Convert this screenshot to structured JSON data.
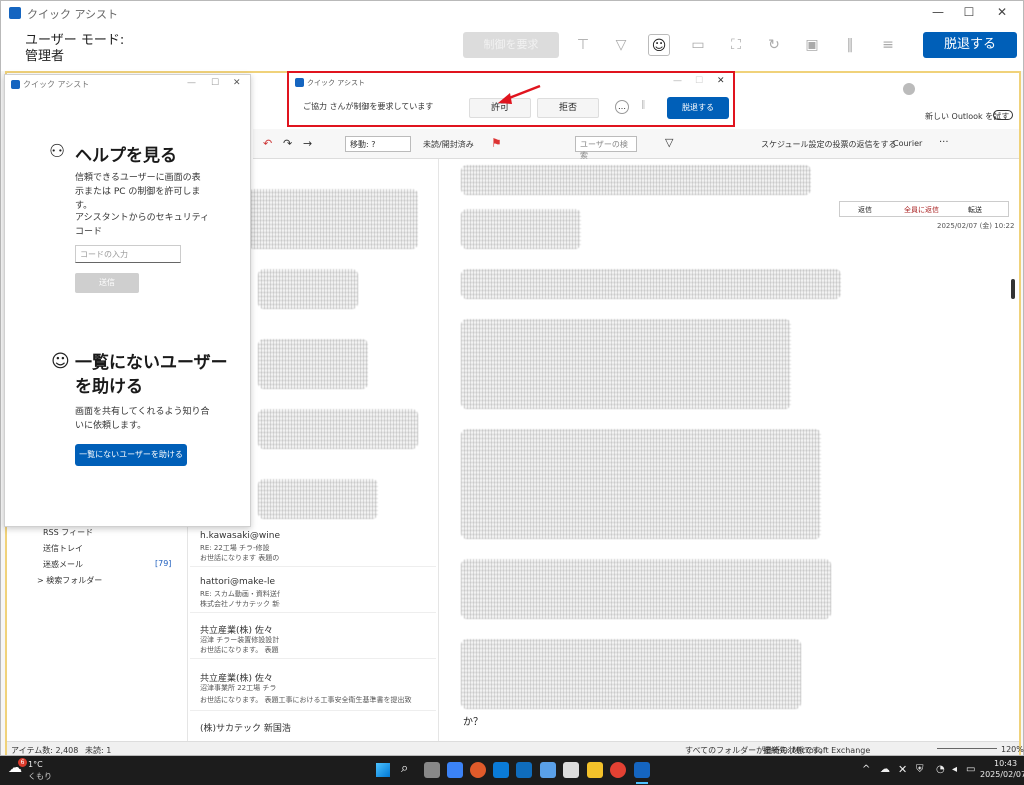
{
  "window": {
    "title": "クイック アシスト",
    "minimize": "—",
    "maximize": "☐",
    "close": "✕"
  },
  "mode": {
    "label": "ユーザー モード:",
    "role": "管理者",
    "disabled_button": "制御を要求",
    "leave_button": "脱退する"
  },
  "dialog": {
    "title": "クイック アシスト",
    "message": "ご協力 さんが制御を要求しています",
    "allow": "許可",
    "deny": "拒否",
    "leave": "脱退する",
    "accent": "#e0141e"
  },
  "help": {
    "title": "クイック アシスト",
    "section1_title": "ヘルプを見る",
    "section1_body": "信頼できるユーザーに画面の表示または PC の制御を許可します。",
    "code_label": "アシスタントからのセキュリティ コード",
    "code_placeholder": "コードの入力",
    "submit": "送信",
    "section2_title": "一覧にないユーザーを助ける",
    "section2_body": "画面を共有してくれるよう知り合いに依頼します。",
    "help_button": "一覧にないユーザーを助ける"
  },
  "outlook": {
    "try_new": "新しい Outlook を試す",
    "ribbon": {
      "move": "移動: ?",
      "unread": "未読/開封済み",
      "search_user": "ユーザーの検索",
      "schedule": "スケジュール設定の投票の返信をする",
      "font": "Courier",
      "more": "···"
    },
    "reading": {
      "reply": "返信",
      "reply_all": "全員に返信",
      "forward": "転送",
      "date": "2025/02/07 (金) 10:22",
      "text": "か？"
    },
    "folders": [
      "RSS フィード",
      "送信トレイ",
      "迷惑メール",
      "> 検索フォルダー"
    ],
    "junk_count": "[79]",
    "mails": [
      {
        "from": "h.kawasaki@wine",
        "subject": "RE: 22工場 チラ-修設",
        "preview": "お世話になります 表題の"
      },
      {
        "from": "hattori@make-le",
        "subject": "RE: スカム動画・資料送付",
        "preview": "株式会社ノサカテック 新発"
      },
      {
        "from": "共立産業(株) 佐々",
        "subject": "沼津 チラー装置修設設計",
        "preview": "お世話になります。 表題"
      },
      {
        "from": "共立産業(株) 佐々",
        "subject": "沼津事業所 22工場 チラ",
        "preview": "お世話になります。 表題工事における工事安全衛生基準書を提出致"
      },
      {
        "from": "(株)サカテック 新国浩",
        "subject": "",
        "preview": ""
      }
    ],
    "status": {
      "items": "アイテム数: 2,408",
      "unread": "未読: 1",
      "sync": "すべてのフォルダーが最新の状態です。",
      "connection": "接続先: Microsoft Exchange",
      "zoom": "120%"
    }
  },
  "taskbar": {
    "weather_temp": "1°C",
    "weather_text": "くもり",
    "weather_badge": "6",
    "time": "10:43",
    "date": "2025/02/07"
  }
}
